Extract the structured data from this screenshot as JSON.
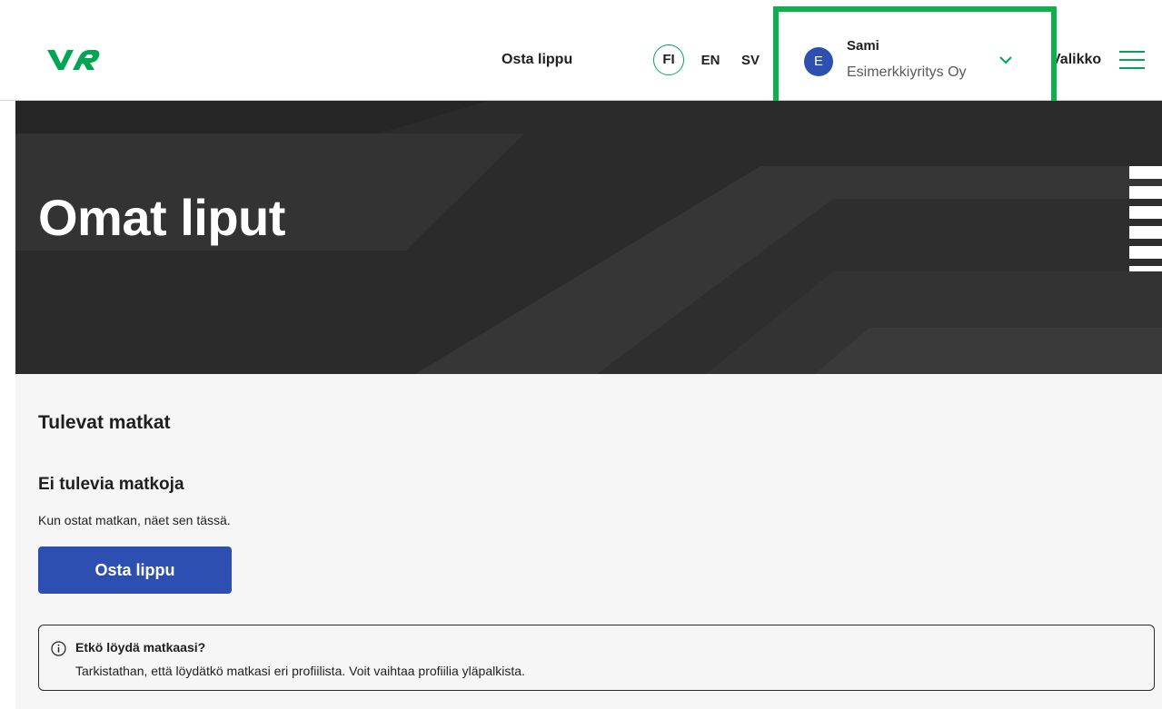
{
  "header": {
    "logo_text": "VR",
    "buy_ticket_link": "Osta lippu",
    "languages": [
      "FI",
      "EN",
      "SV"
    ],
    "active_language": "FI",
    "profile": {
      "avatar_initial": "E",
      "name": "Sami",
      "company": "Esimerkkiyritys Oy"
    },
    "menu_label": "Valikko"
  },
  "hero": {
    "title": "Omat liput"
  },
  "upcoming": {
    "section_title": "Tulevat matkat",
    "empty_title": "Ei tulevia matkoja",
    "empty_text": "Kun ostat matkan, näet sen tässä.",
    "buy_button": "Osta lippu"
  },
  "info": {
    "title": "Etkö löydä matkaasi?",
    "text": "Tarkistathan, että löydätkö matkasi eri profiilista. Voit vaihtaa profiilia yläpalkista."
  },
  "colors": {
    "brand_green": "#00a651",
    "highlight_green": "#0db14b",
    "primary_blue": "#2e4fb2",
    "hero_dark": "#2b2b2b"
  }
}
